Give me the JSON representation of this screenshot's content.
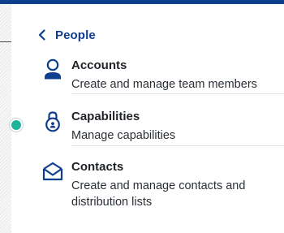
{
  "nav": {
    "back_label": "People",
    "back_icon": "chevron-left-icon"
  },
  "items": [
    {
      "title": "Accounts",
      "description": "Create and manage team members",
      "icon": "person-icon"
    },
    {
      "title": "Capabilities",
      "description": "Manage capabilities",
      "icon": "lock-icon"
    },
    {
      "title": "Contacts",
      "description": "Create and manage contacts and distribution lists",
      "icon": "envelope-open-icon"
    }
  ],
  "colors": {
    "accent": "#0f3e8e",
    "handle": "#1fb39a",
    "text": "#1f2328",
    "divider": "#e3e5e8"
  }
}
